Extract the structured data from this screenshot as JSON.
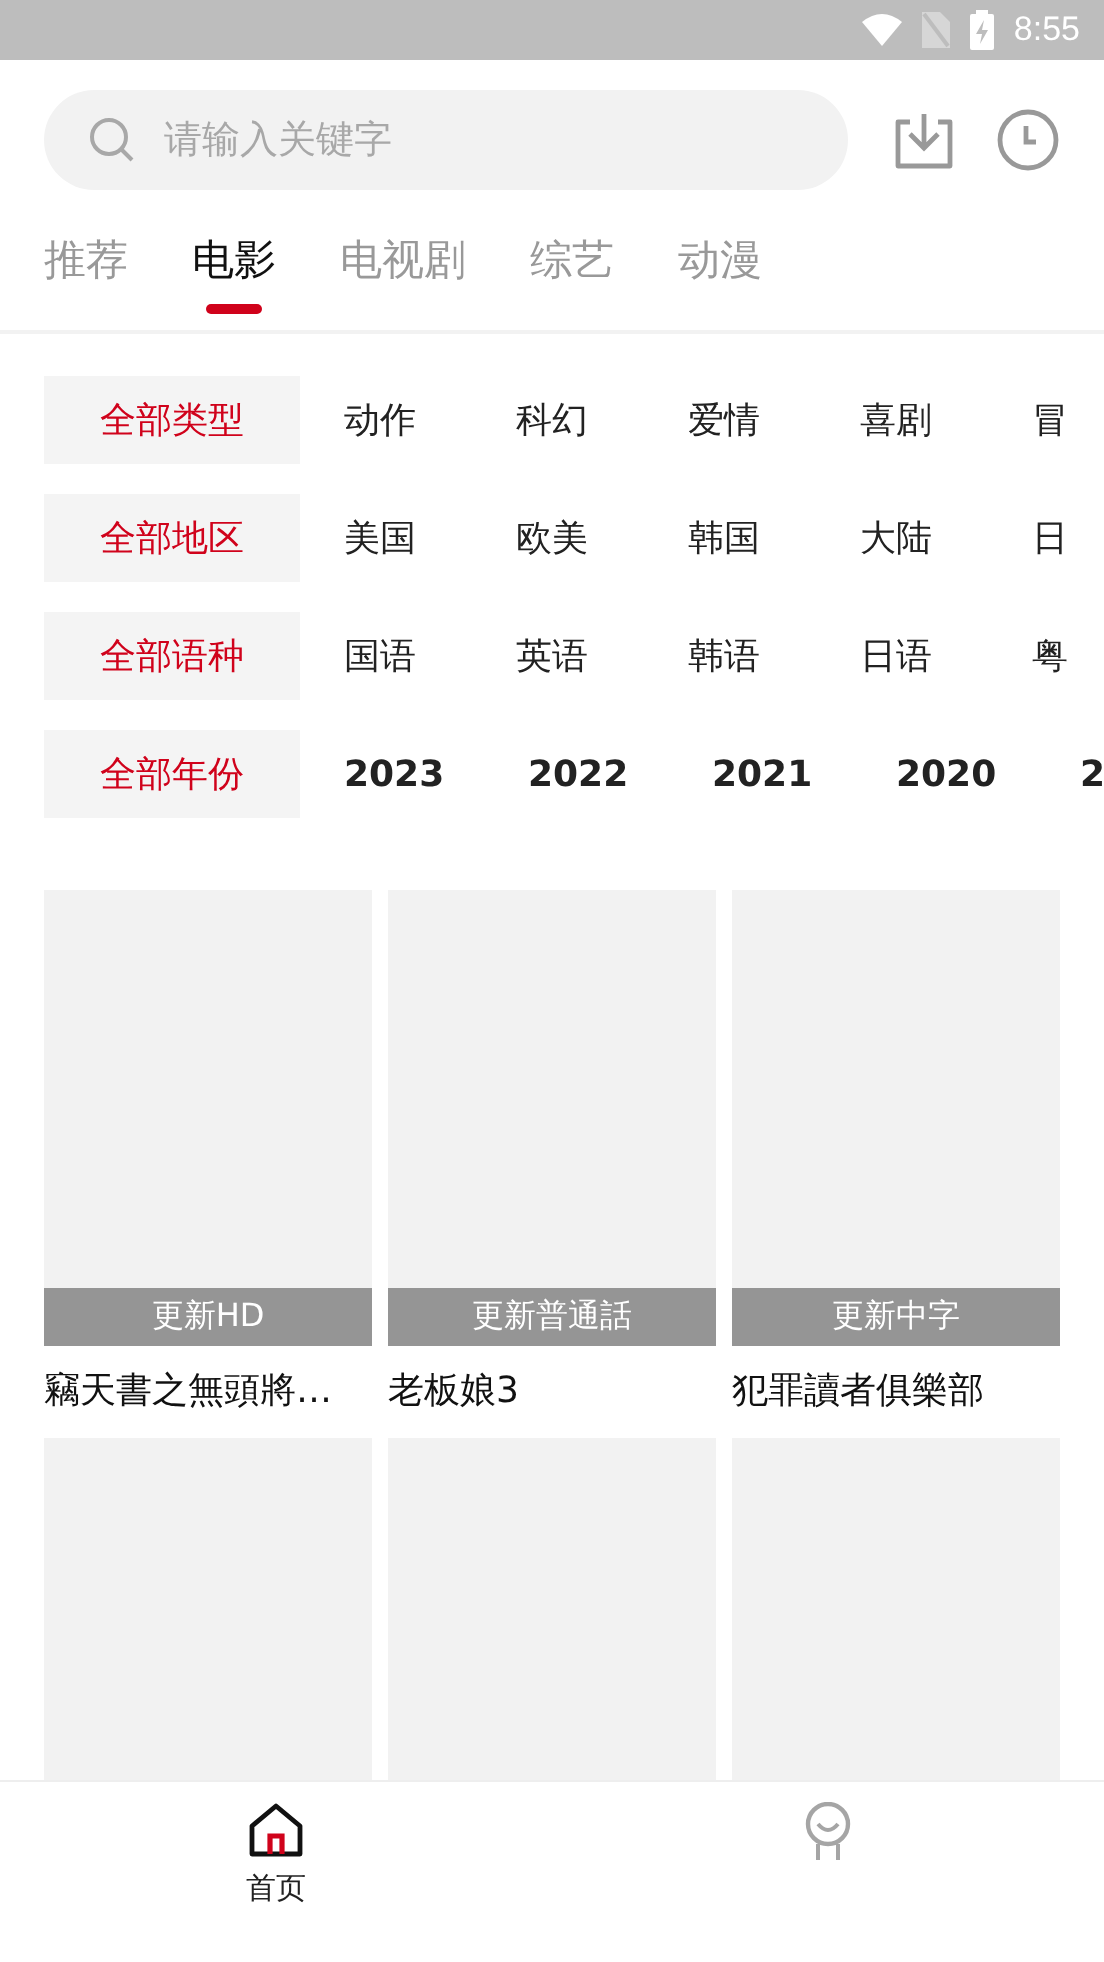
{
  "status_bar": {
    "time": "8:55"
  },
  "search": {
    "placeholder": "请输入关键字"
  },
  "tabs": [
    {
      "label": "推荐",
      "selected": false
    },
    {
      "label": "电影",
      "selected": true
    },
    {
      "label": "电视剧",
      "selected": false
    },
    {
      "label": "综艺",
      "selected": false
    },
    {
      "label": "动漫",
      "selected": false
    }
  ],
  "filters": [
    {
      "kind": "text",
      "options": [
        {
          "label": "全部类型",
          "selected": true
        },
        {
          "label": "动作",
          "selected": false
        },
        {
          "label": "科幻",
          "selected": false
        },
        {
          "label": "爱情",
          "selected": false
        },
        {
          "label": "喜剧",
          "selected": false
        },
        {
          "label": "冒",
          "selected": false
        }
      ]
    },
    {
      "kind": "text",
      "options": [
        {
          "label": "全部地区",
          "selected": true
        },
        {
          "label": "美国",
          "selected": false
        },
        {
          "label": "欧美",
          "selected": false
        },
        {
          "label": "韩国",
          "selected": false
        },
        {
          "label": "大陆",
          "selected": false
        },
        {
          "label": "日",
          "selected": false
        }
      ]
    },
    {
      "kind": "text",
      "options": [
        {
          "label": "全部语种",
          "selected": true
        },
        {
          "label": "国语",
          "selected": false
        },
        {
          "label": "英语",
          "selected": false
        },
        {
          "label": "韩语",
          "selected": false
        },
        {
          "label": "日语",
          "selected": false
        },
        {
          "label": "粤",
          "selected": false
        }
      ]
    },
    {
      "kind": "year",
      "options": [
        {
          "label": "全部年份",
          "selected": true
        },
        {
          "label": "2023",
          "selected": false
        },
        {
          "label": "2022",
          "selected": false
        },
        {
          "label": "2021",
          "selected": false
        },
        {
          "label": "2020",
          "selected": false
        },
        {
          "label": "2",
          "selected": false
        }
      ]
    }
  ],
  "movies": [
    {
      "badge": "更新HD",
      "title": "竊天書之無頭將…"
    },
    {
      "badge": "更新普通話",
      "title": "老板娘3"
    },
    {
      "badge": "更新中字",
      "title": "犯罪讀者俱樂部"
    },
    {
      "kind": "poster"
    },
    {
      "kind": "poster"
    },
    {
      "kind": "poster"
    }
  ],
  "bottom_nav": [
    {
      "kind": "home",
      "label": "首页",
      "selected": true
    },
    {
      "kind": "profile",
      "selected": false
    }
  ]
}
